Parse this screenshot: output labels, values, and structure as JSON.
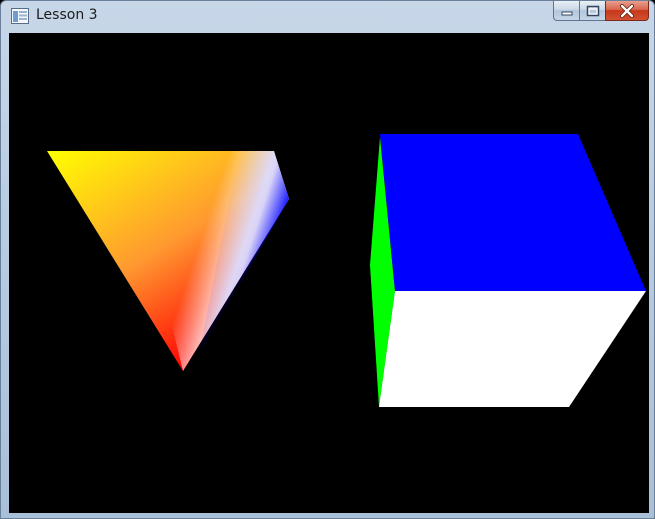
{
  "window": {
    "title": "Lesson 3",
    "icons": {
      "app": "app-window-icon",
      "minimize": "minimize-icon",
      "maximize": "maximize-icon",
      "close": "close-icon"
    }
  },
  "scene": {
    "background": "#000000",
    "triangle": {
      "vertex_colors": {
        "top_left": "#ffff00",
        "top_right": "#ffffff",
        "right": "#0000ff",
        "bottom": "#ff0000"
      }
    },
    "cube": {
      "face_colors": {
        "top": "#0000ff",
        "front": "#ffffff",
        "side": "#00ff00"
      }
    }
  }
}
